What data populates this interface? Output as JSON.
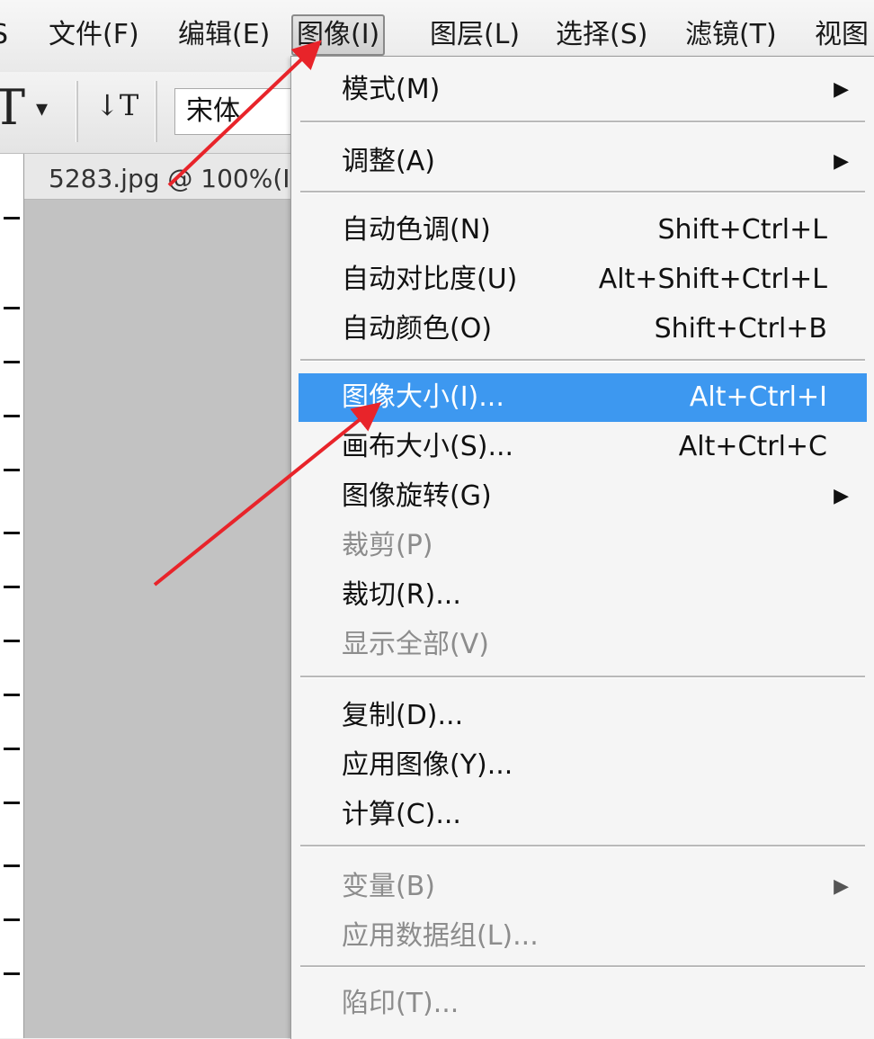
{
  "menubar": {
    "items": [
      {
        "id": "s",
        "label": "S"
      },
      {
        "id": "file",
        "label": "文件(F)"
      },
      {
        "id": "edit",
        "label": "编辑(E)"
      },
      {
        "id": "image",
        "label": "图像(I)"
      },
      {
        "id": "layer",
        "label": "图层(L)"
      },
      {
        "id": "select",
        "label": "选择(S)"
      },
      {
        "id": "filter",
        "label": "滤镜(T)"
      },
      {
        "id": "view",
        "label": "视图"
      }
    ]
  },
  "options_bar": {
    "text_tool_glyph": "T",
    "dropdown_glyph": "▾",
    "orientation_glyph": "↓T",
    "font_family_value": "宋体"
  },
  "document": {
    "tab_title": "5283.jpg @ 100%(I"
  },
  "image_menu": {
    "items": [
      {
        "label": "模式(M)",
        "shortcut": "",
        "submenu": true,
        "disabled": false,
        "highlighted": false
      },
      {
        "label": "调整(A)",
        "shortcut": "",
        "submenu": true,
        "disabled": false,
        "highlighted": false
      },
      {
        "label": "自动色调(N)",
        "shortcut": "Shift+Ctrl+L",
        "submenu": false,
        "disabled": false,
        "highlighted": false
      },
      {
        "label": "自动对比度(U)",
        "shortcut": "Alt+Shift+Ctrl+L",
        "submenu": false,
        "disabled": false,
        "highlighted": false
      },
      {
        "label": "自动颜色(O)",
        "shortcut": "Shift+Ctrl+B",
        "submenu": false,
        "disabled": false,
        "highlighted": false
      },
      {
        "label": "图像大小(I)...",
        "shortcut": "Alt+Ctrl+I",
        "submenu": false,
        "disabled": false,
        "highlighted": true
      },
      {
        "label": "画布大小(S)...",
        "shortcut": "Alt+Ctrl+C",
        "submenu": false,
        "disabled": false,
        "highlighted": false
      },
      {
        "label": "图像旋转(G)",
        "shortcut": "",
        "submenu": true,
        "disabled": false,
        "highlighted": false
      },
      {
        "label": "裁剪(P)",
        "shortcut": "",
        "submenu": false,
        "disabled": true,
        "highlighted": false
      },
      {
        "label": "裁切(R)...",
        "shortcut": "",
        "submenu": false,
        "disabled": false,
        "highlighted": false
      },
      {
        "label": "显示全部(V)",
        "shortcut": "",
        "submenu": false,
        "disabled": true,
        "highlighted": false
      },
      {
        "label": "复制(D)...",
        "shortcut": "",
        "submenu": false,
        "disabled": false,
        "highlighted": false
      },
      {
        "label": "应用图像(Y)...",
        "shortcut": "",
        "submenu": false,
        "disabled": false,
        "highlighted": false
      },
      {
        "label": "计算(C)...",
        "shortcut": "",
        "submenu": false,
        "disabled": false,
        "highlighted": false
      },
      {
        "label": "变量(B)",
        "shortcut": "",
        "submenu": true,
        "disabled": true,
        "highlighted": false
      },
      {
        "label": "应用数据组(L)...",
        "shortcut": "",
        "submenu": false,
        "disabled": true,
        "highlighted": false
      },
      {
        "label": "陷印(T)...",
        "shortcut": "",
        "submenu": false,
        "disabled": true,
        "highlighted": false
      }
    ],
    "submenu_arrow_glyph": "▶"
  },
  "colors": {
    "highlight": "#3d98f0",
    "annotation_arrow": "#e8242a",
    "disabled_text": "#8c8c8c"
  }
}
